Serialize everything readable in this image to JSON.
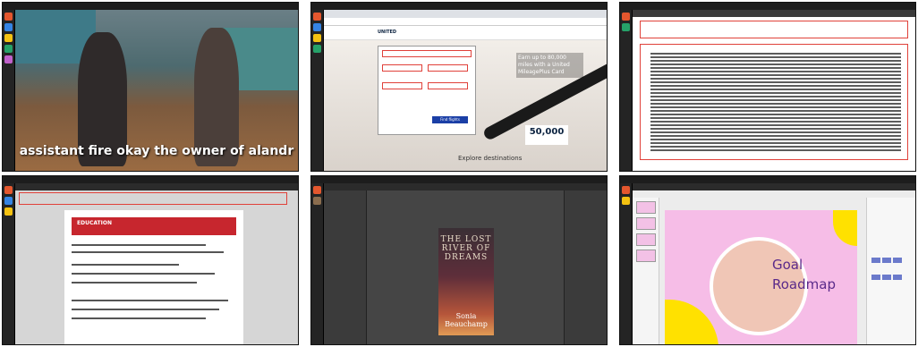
{
  "tiles": {
    "video": {
      "subtitle": "assistant fire okay the owner of alandr"
    },
    "browser": {
      "logo": "UNITED",
      "offer_text": "Earn up to 80,000 miles with a United MileagePlus Card",
      "miles_value": "50,000",
      "explore_label": "Explore destinations",
      "find_flights_label": "Find flights"
    },
    "spreadsheet": {},
    "writer": {
      "logo": "EDUCATION"
    },
    "gimp": {
      "cover_title": "THE LOST RIVER OF DREAMS",
      "cover_author": "Sonia Beauchamp"
    },
    "impress": {
      "slide_title_1": "Goal",
      "slide_title_2": "Roadmap"
    }
  },
  "colors": {
    "annotation_box": "#e0413a",
    "united_blue": "#1b3fa6",
    "slide_pink": "#f6bde7",
    "slide_yellow": "#ffe100"
  }
}
